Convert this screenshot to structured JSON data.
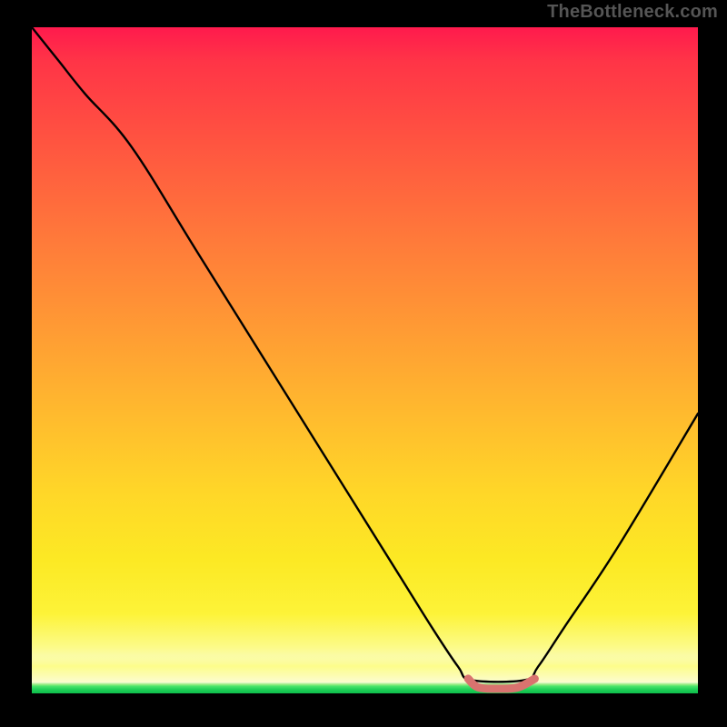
{
  "watermark": "TheBottleneck.com",
  "colors": {
    "page_bg": "#000000",
    "gradient_top": "#ff1a4d",
    "gradient_mid": "#ffd728",
    "gradient_bottom_yellow": "#fcfb88",
    "gradient_green": "#1fcf57",
    "curve_black": "#000000",
    "flat_segment": "#d9736f"
  },
  "chart_data": {
    "type": "line",
    "title": "",
    "xlabel": "",
    "ylabel": "",
    "xlim": [
      0,
      100
    ],
    "ylim": [
      0,
      100
    ],
    "grid": false,
    "series": [
      {
        "name": "bottleneck-curve",
        "color": "#000000",
        "x": [
          0,
          4,
          8,
          15,
          25,
          40,
          55,
          60,
          64,
          66,
          74,
          76,
          80,
          88,
          100
        ],
        "y": [
          100,
          95,
          90,
          82,
          66,
          42,
          18,
          10,
          4,
          2,
          2,
          4,
          10,
          22,
          42
        ]
      }
    ],
    "highlight_segment": {
      "name": "optimal-range",
      "color": "#d9736f",
      "x": [
        65.5,
        67,
        70,
        73,
        75.5
      ],
      "y": [
        2.2,
        0.9,
        0.7,
        0.9,
        2.2
      ]
    },
    "annotations": []
  }
}
